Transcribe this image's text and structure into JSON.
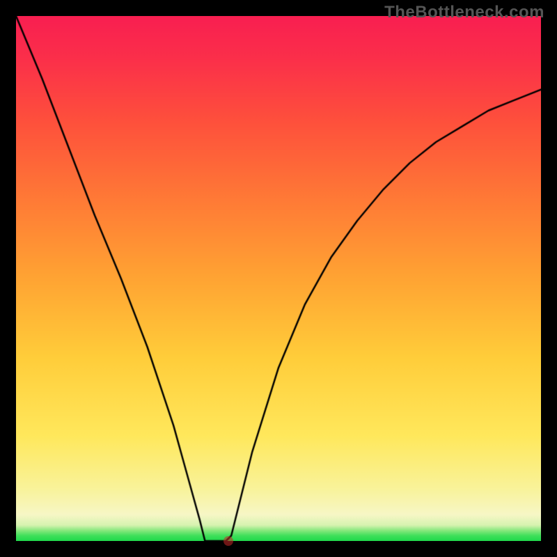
{
  "watermark": "TheBottleneck.com",
  "chart_data": {
    "type": "line",
    "title": "",
    "xlabel": "",
    "ylabel": "",
    "xlim": [
      0,
      1
    ],
    "ylim": [
      0,
      1
    ],
    "series": [
      {
        "name": "curve",
        "x": [
          0.0,
          0.05,
          0.1,
          0.15,
          0.2,
          0.25,
          0.3,
          0.325,
          0.35,
          0.36,
          0.4,
          0.41,
          0.45,
          0.5,
          0.55,
          0.6,
          0.65,
          0.7,
          0.75,
          0.8,
          0.85,
          0.9,
          0.95,
          1.0
        ],
        "y": [
          1.0,
          0.88,
          0.75,
          0.62,
          0.5,
          0.37,
          0.22,
          0.13,
          0.04,
          0.0,
          0.0,
          0.01,
          0.17,
          0.33,
          0.45,
          0.54,
          0.61,
          0.67,
          0.72,
          0.76,
          0.79,
          0.82,
          0.84,
          0.86
        ]
      }
    ],
    "gradient_stops": [
      {
        "offset": 0.0,
        "color": "#1fd94b"
      },
      {
        "offset": 0.01,
        "color": "#3fe05a"
      },
      {
        "offset": 0.02,
        "color": "#87e87e"
      },
      {
        "offset": 0.03,
        "color": "#d6f3b0"
      },
      {
        "offset": 0.05,
        "color": "#f7f7c6"
      },
      {
        "offset": 0.1,
        "color": "#f9f39a"
      },
      {
        "offset": 0.2,
        "color": "#ffe85c"
      },
      {
        "offset": 0.35,
        "color": "#ffcd3a"
      },
      {
        "offset": 0.5,
        "color": "#ffa433"
      },
      {
        "offset": 0.65,
        "color": "#ff7a36"
      },
      {
        "offset": 0.8,
        "color": "#fe503c"
      },
      {
        "offset": 0.92,
        "color": "#fb2f4a"
      },
      {
        "offset": 1.0,
        "color": "#f91f51"
      }
    ],
    "marker": {
      "x": 0.405,
      "y": 0.0
    }
  }
}
